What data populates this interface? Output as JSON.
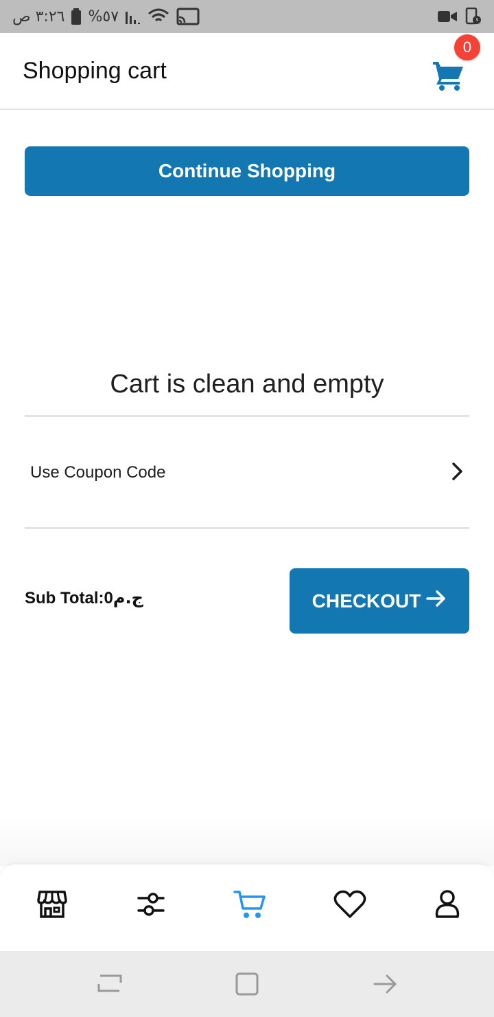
{
  "status_bar": {
    "time": "٣:٢٦ ص",
    "battery": "%٥٧",
    "icons": [
      "battery-icon",
      "signal-icon",
      "wifi-icon",
      "cast-icon",
      "video-call-icon",
      "screen-lock-icon"
    ]
  },
  "header": {
    "title": "Shopping cart",
    "cart_count": "0",
    "cart_icon": "cart-icon"
  },
  "continue_button": {
    "label": "Continue Shopping"
  },
  "empty_message": "Cart is clean and empty",
  "coupon": {
    "label": "Use Coupon Code",
    "icon": "chevron-right-icon"
  },
  "summary": {
    "subtotal_label": "Sub Total: ",
    "subtotal_value": "0",
    "currency": "ج.م"
  },
  "checkout_button": {
    "label": "CHECKOUT",
    "icon": "arrow-right-icon"
  },
  "bottom_nav": {
    "items": [
      {
        "name": "store",
        "icon": "store-icon",
        "active": false
      },
      {
        "name": "filters",
        "icon": "sliders-icon",
        "active": false
      },
      {
        "name": "cart",
        "icon": "cart-icon",
        "active": true
      },
      {
        "name": "wishlist",
        "icon": "heart-icon",
        "active": false
      },
      {
        "name": "profile",
        "icon": "user-icon",
        "active": false
      }
    ]
  },
  "colors": {
    "primary": "#1377b2",
    "active_nav": "#2196f3",
    "badge": "#f44336",
    "status_bar": "#bdbdbd"
  }
}
